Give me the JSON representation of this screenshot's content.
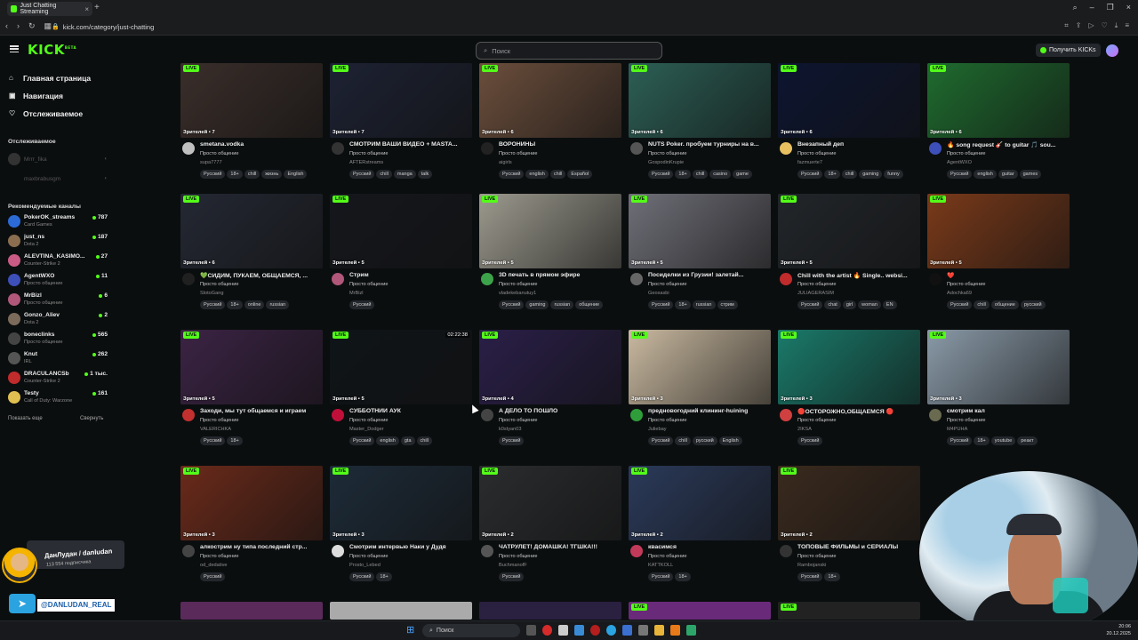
{
  "browser": {
    "tab_title": "Just Chatting Streaming",
    "url": "kick.com/category/just-chatting"
  },
  "header": {
    "logo": "KICK",
    "logo_sup": "BETA",
    "search_placeholder": "Поиск",
    "kicks_button": "Получить KICKs"
  },
  "sidebar": {
    "nav": [
      {
        "label": "Главная страница",
        "icon": "home-icon"
      },
      {
        "label": "Навигация",
        "icon": "compass-icon"
      },
      {
        "label": "Отслеживаемое",
        "icon": "heart-icon"
      }
    ],
    "following_heading": "Отслеживаемое",
    "following": [
      {
        "name": "Mrrr_fika"
      },
      {
        "name": "maxbrabusgm"
      }
    ],
    "recommended_heading": "Рекомендуемые каналы",
    "recommended": [
      {
        "name": "PokerOK_streams",
        "category": "Card Games",
        "viewers": "787",
        "color": "#2c6ad6"
      },
      {
        "name": "just_ns",
        "category": "Dota 2",
        "viewers": "187",
        "color": "#8a6e4f"
      },
      {
        "name": "ALEVTINA_KASIMO...",
        "category": "Counter-Strike 2",
        "viewers": "27",
        "color": "#c95b84"
      },
      {
        "name": "AgentWXO",
        "category": "Просто общение",
        "viewers": "11",
        "color": "#3d4fb8"
      },
      {
        "name": "MrBizl",
        "category": "Просто общение",
        "viewers": "6",
        "color": "#b0577a"
      },
      {
        "name": "Gonzo_Aliev",
        "category": "Dota 2",
        "viewers": "2",
        "color": "#7c6b5b"
      },
      {
        "name": "boneclinks",
        "category": "Просто общение",
        "viewers": "565",
        "color": "#444"
      },
      {
        "name": "Knut",
        "category": "IRL",
        "viewers": "262",
        "color": "#555"
      },
      {
        "name": "DRACULANCSb",
        "category": "Counter-Strike 2",
        "viewers": "1 тыс.",
        "color": "#c02b2b"
      },
      {
        "name": "Testy",
        "category": "Call of Duty: Warzone",
        "viewers": "161",
        "color": "#e0c050"
      }
    ],
    "show_more": "Показать еще",
    "collapse": "Свернуть"
  },
  "live_label": "LIVE",
  "cards": [
    {
      "row": 0,
      "col": 0,
      "viewers": "Зрителей • 7",
      "title": "smetana.vodka",
      "category": "Просто общение",
      "channel": "supa7777",
      "tags": [
        "Русский",
        "18+",
        "chill",
        "жизнь",
        "English"
      ],
      "thumb": "#3a2e2a",
      "avatar": "#c0c0c0"
    },
    {
      "row": 0,
      "col": 1,
      "viewers": "Зрителей • 7",
      "title": "СМОТРИМ ВАШИ ВИДЕО + MASTA...",
      "category": "Просто общение",
      "channel": "AFTERstreams",
      "tags": [
        "Русский",
        "chill",
        "manga",
        "talk"
      ],
      "thumb": "#1d2233",
      "avatar": "#333"
    },
    {
      "row": 0,
      "col": 2,
      "viewers": "Зрителей • 6",
      "title": "ВОРОНИНЫ",
      "category": "Просто общение",
      "channel": "aigirls",
      "tags": [
        "Русский",
        "english",
        "chill",
        "Español"
      ],
      "thumb": "#6b4e3c",
      "avatar": "#222"
    },
    {
      "row": 0,
      "col": 3,
      "viewers": "Зрителей • 6",
      "title": "NUTS Poker. пробуем турниры на в...",
      "category": "Просто общение",
      "channel": "GospodinKrupie",
      "tags": [
        "Русский",
        "18+",
        "chill",
        "casino",
        "game"
      ],
      "thumb": "#2c5f55",
      "avatar": "#555"
    },
    {
      "row": 0,
      "col": 4,
      "viewers": "Зрителей • 6",
      "title": "Внезапный деп",
      "category": "Просто общение",
      "channel": "fazmuerte7",
      "tags": [
        "Русский",
        "18+",
        "chill",
        "gaming",
        "funny"
      ],
      "thumb": "#0d1530",
      "avatar": "#e8c060"
    },
    {
      "row": 0,
      "col": 5,
      "viewers": "Зрителей • 6",
      "title": "🔥 song request 🎸 to guitar 🎵 sou...",
      "category": "Просто общение",
      "channel": "AgentWXO",
      "tags": [
        "Русский",
        "english",
        "guitar",
        "games"
      ],
      "thumb": "#1f6b2f",
      "avatar": "#3d4fb8"
    },
    {
      "row": 1,
      "col": 0,
      "viewers": "Зрителей • 6",
      "title": "💚СИДИМ, ПУКАЕМ, ОБЩАЕМСЯ, ...",
      "category": "Просто общение",
      "channel": "SlotoGang",
      "tags": [
        "Русский",
        "18+",
        "online",
        "russian"
      ],
      "thumb": "#242833",
      "avatar": "#202020"
    },
    {
      "row": 1,
      "col": 1,
      "viewers": "Зрителей • 5",
      "title": "Стрим",
      "category": "Просто общение",
      "channel": "MrBizl",
      "tags": [
        "Русский"
      ],
      "thumb": "#15171c",
      "avatar": "#b0577a"
    },
    {
      "row": 1,
      "col": 2,
      "viewers": "Зрителей • 5",
      "title": "3D печать в прямом эфире",
      "category": "Просто общение",
      "channel": "vladekebanutuy1",
      "tags": [
        "Русский",
        "gaming",
        "russian",
        "общение"
      ],
      "thumb": "#9c9a8e",
      "avatar": "#3da34a"
    },
    {
      "row": 1,
      "col": 3,
      "viewers": "Зрителей • 5",
      "title": "Посиделки из Грузии! залетай...",
      "category": "Просто общение",
      "channel": "Geoxasbi",
      "tags": [
        "Русский",
        "18+",
        "russian",
        "стрим"
      ],
      "thumb": "#6f6f78",
      "avatar": "#666"
    },
    {
      "row": 1,
      "col": 4,
      "viewers": "Зрителей • 5",
      "title": "Chill with the artist 🔥 Single.. websi...",
      "category": "Просто общение",
      "channel": "JULIAGERASIM",
      "tags": [
        "Русский",
        "chat",
        "girl",
        "woman",
        "EN"
      ],
      "thumb": "#22262a",
      "avatar": "#c02b2b"
    },
    {
      "row": 1,
      "col": 5,
      "viewers": "Зрителей • 5",
      "title": "❤️",
      "category": "Просто общение",
      "channel": "Adochka69",
      "tags": [
        "Русский",
        "chill",
        "общение",
        "русский"
      ],
      "thumb": "#7a3a1a",
      "avatar": "#111"
    },
    {
      "row": 2,
      "col": 0,
      "viewers": "Зрителей • 5",
      "title": "Заходи, мы тут общаемся и играем",
      "category": "Просто общение",
      "channel": "VALERICHKA",
      "tags": [
        "Русский",
        "18+"
      ],
      "thumb": "#3b2344",
      "avatar": "#c23030"
    },
    {
      "row": 2,
      "col": 1,
      "viewers": "Зрителей • 5",
      "title": "СУББОТНИЙ АУК",
      "category": "Просто общение",
      "channel": "Master_Dodger",
      "tags": [
        "Русский",
        "english",
        "gta",
        "chill"
      ],
      "thumb": "#0f1418",
      "avatar": "#c0103a",
      "duration": "02:22:38"
    },
    {
      "row": 2,
      "col": 2,
      "viewers": "Зрителей • 4",
      "title": "А ДЕЛО ТО ПОШЛО",
      "category": "Просто общение",
      "channel": "k0styan03",
      "tags": [
        "Русский"
      ],
      "thumb": "#2a1f48",
      "avatar": "#444"
    },
    {
      "row": 2,
      "col": 3,
      "viewers": "Зрителей • 3",
      "title": "предновогодний клининг-huining",
      "category": "Просто общение",
      "channel": "Juliebay",
      "tags": [
        "Русский",
        "chill",
        "русский",
        "English"
      ],
      "thumb": "#c9b9a0",
      "avatar": "#2f9e3a"
    },
    {
      "row": 2,
      "col": 4,
      "viewers": "Зрителей • 3",
      "title": "🔴ОСТОРОЖНО,ОБЩАЕМСЯ 🔴",
      "category": "Просто общение",
      "channel": "2IKSA",
      "tags": [
        "Русский"
      ],
      "thumb": "#1a7a6a",
      "avatar": "#d04040"
    },
    {
      "row": 2,
      "col": 5,
      "viewers": "Зрителей • 3",
      "title": "смотрим кал",
      "category": "Просто общение",
      "channel": "M4PUHA",
      "tags": [
        "Русский",
        "18+",
        "youtube",
        "реакт"
      ],
      "thumb": "#8a9aa8",
      "avatar": "#6a6a50"
    },
    {
      "row": 3,
      "col": 0,
      "viewers": "Зрителей • 3",
      "title": "алкострим ну типа последний стр...",
      "category": "Просто общение",
      "channel": "od_dedative",
      "tags": [
        "Русский"
      ],
      "thumb": "#6a2a1a",
      "avatar": "#444"
    },
    {
      "row": 3,
      "col": 1,
      "viewers": "Зрителей • 3",
      "title": "Смотрим интервью Наки у Дудя",
      "category": "Просто общение",
      "channel": "Prosto_Lebed",
      "tags": [
        "Русский",
        "18+"
      ],
      "thumb": "#1d2b38",
      "avatar": "#ddd"
    },
    {
      "row": 3,
      "col": 2,
      "viewers": "Зрителей • 2",
      "title": "ЧАТРУЛЕТ! ДОМАШКА! ТГШКА!!!",
      "category": "Просто общение",
      "channel": "BuchmanofF",
      "tags": [
        "Русский"
      ],
      "thumb": "#2a2c2e",
      "avatar": "#555"
    },
    {
      "row": 3,
      "col": 3,
      "viewers": "Зрителей • 2",
      "title": "квасимся",
      "category": "Просто общение",
      "channel": "KATTKOLL",
      "tags": [
        "Русский",
        "18+"
      ],
      "thumb": "#2b3a5a",
      "avatar": "#c23a5a"
    },
    {
      "row": 3,
      "col": 4,
      "viewers": "Зрителей • 2",
      "title": "ТОПОВЫЕ ФИЛЬМЫ и СЕРИАЛЫ",
      "category": "Просто общение",
      "channel": "Rambojanski",
      "tags": [
        "Русский",
        "18+"
      ],
      "thumb": "#3a2a1e",
      "avatar": "#333"
    }
  ],
  "overlay": {
    "streamer_name": "ДанЛудан / danludan",
    "streamer_subs": "113 554 подписчика",
    "telegram": "@DANLUDAN_REAL"
  },
  "taskbar": {
    "search": "Поиск",
    "time": "20:06",
    "date": "20.12.2025"
  }
}
